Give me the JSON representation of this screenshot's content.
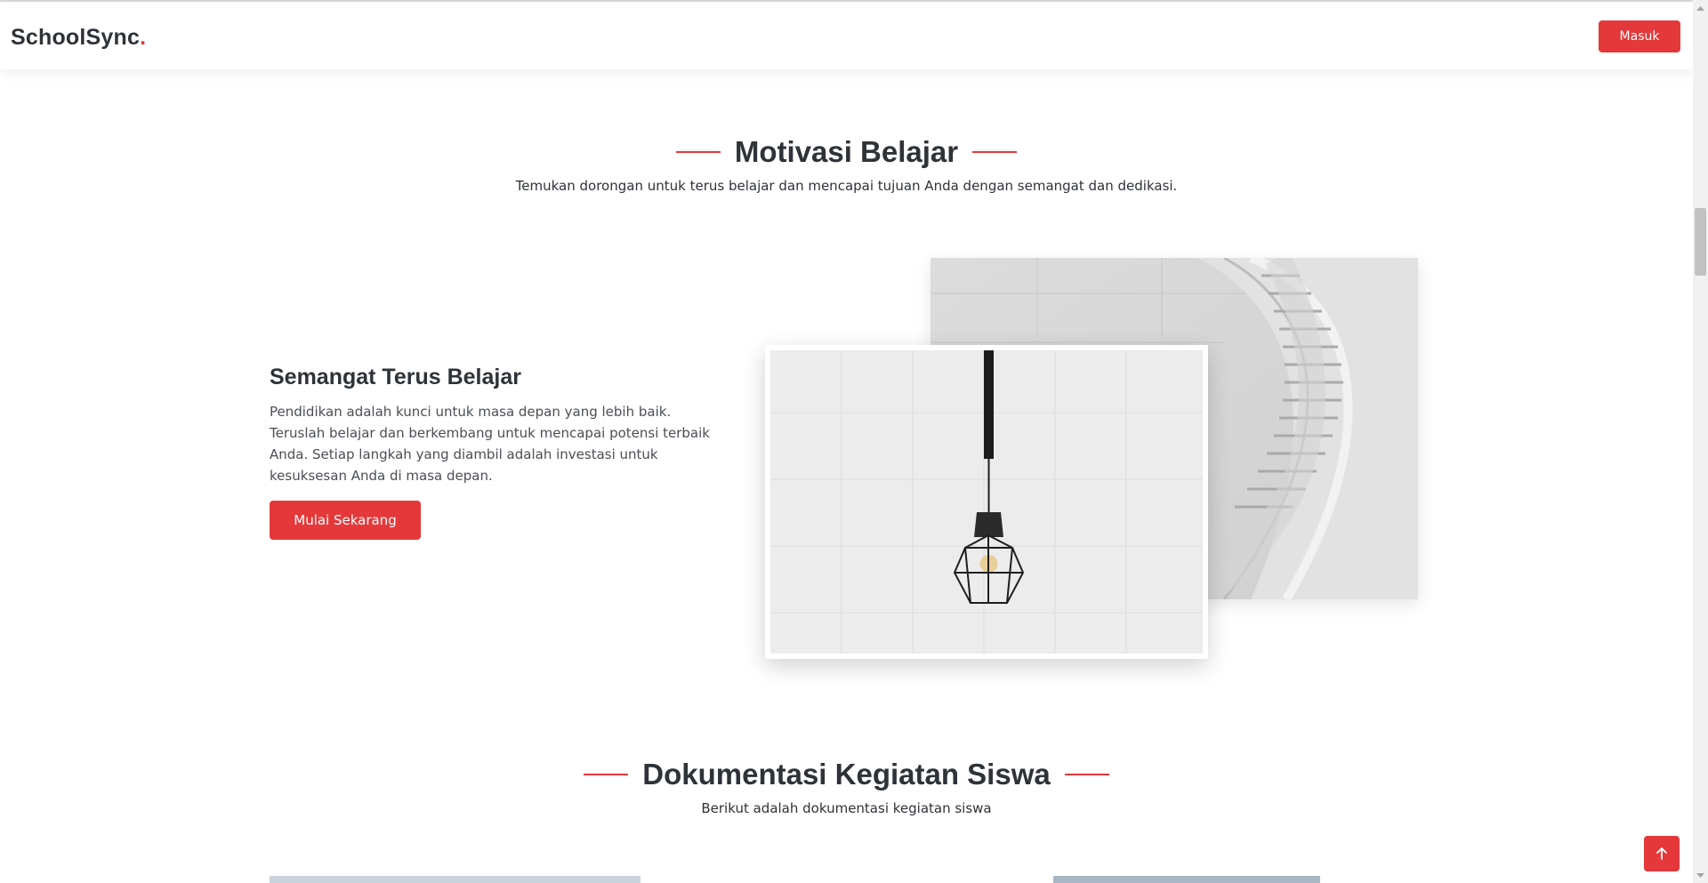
{
  "header": {
    "brand": "SchoolSync",
    "brand_dot": ".",
    "login_label": "Masuk"
  },
  "motivation": {
    "title": "Motivasi Belajar",
    "subtitle": "Temukan dorongan untuk terus belajar dan mencapai tujuan Anda dengan semangat dan dedikasi.",
    "heading": "Semangat Terus Belajar",
    "body": "Pendidikan adalah kunci untuk masa depan yang lebih baik. Teruslah belajar dan berkembang untuk mencapai potensi terbaik Anda. Setiap langkah yang diambil adalah investasi untuk kesuksesan Anda di masa depan.",
    "cta_label": "Mulai Sekarang"
  },
  "documentation": {
    "title": "Dokumentasi Kegiatan Siswa",
    "subtitle": "Berikut adalah dokumentasi kegiatan siswa"
  },
  "icons": {
    "back_to_top": "arrow-up-icon",
    "staircase": "staircase-photo",
    "lamp": "pendant-lamp-photo"
  },
  "colors": {
    "accent": "#e5383b",
    "text": "#2e3338"
  }
}
